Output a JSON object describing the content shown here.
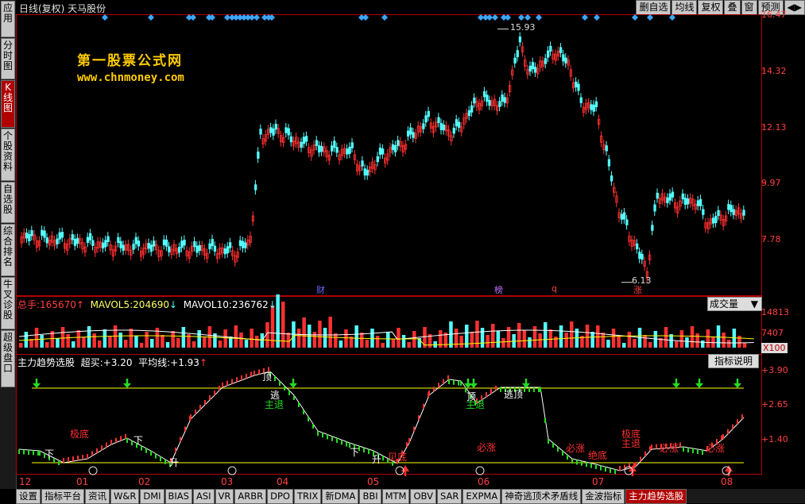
{
  "left_nav": [
    "应用",
    "分时图",
    "K线图",
    "个股资料",
    "自选股",
    "综合排名",
    "牛叉诊股",
    "超级盘口"
  ],
  "left_nav_active": 2,
  "top": {
    "title": "日线(复权)  天马股份",
    "buttons": [
      "删自选",
      "均线",
      "复权",
      "叠",
      "窗",
      "预测"
    ],
    "arrow": "◀▶"
  },
  "watermark": {
    "line1": "第一股票公式网",
    "line2": "www.chnmoney.com"
  },
  "price_axis": [
    "16.47",
    "14.32",
    "12.13",
    "9.97",
    "7.78"
  ],
  "annotations": {
    "high": "15.93",
    "low": "6.13",
    "mark_cai": "财",
    "mark_bang": "榜",
    "mark_q": "q",
    "mark_zhang": "涨"
  },
  "volume": {
    "legend_total_label": "总手:",
    "legend_total": "165670",
    "ma5_label": "MAVOL5:",
    "ma5": "204690",
    "ma10_label": "MAVOL10:",
    "ma10": "236762",
    "dropdown": "成交量",
    "axis": [
      "14813",
      "7407",
      "X100"
    ]
  },
  "indicator": {
    "name": "主力趋势选股",
    "buy_label": "超买:",
    "buy": "+3.20",
    "avg_label": "平均线:",
    "avg": "+1.93",
    "button": "指标说明",
    "axis": [
      "+3.90",
      "+2.65",
      "+1.40"
    ],
    "labels": [
      "极底",
      "顶",
      "逃",
      "主退",
      "顶",
      "主退",
      "逃顶",
      "必涨",
      "绝底",
      "极底",
      "主退",
      "必涨",
      "必涨",
      "必涨",
      "见底",
      "下",
      "下",
      "下",
      "升",
      "升"
    ]
  },
  "time_axis": [
    "12",
    "01",
    "02",
    "03",
    "04",
    "05",
    "06",
    "07",
    "08"
  ],
  "bottom_tabs": [
    "设置",
    "指标平台",
    "资讯",
    "W&R",
    "DMI",
    "BIAS",
    "ASI",
    "VR",
    "ARBR",
    "DPO",
    "TRIX",
    "新DMA",
    "BBI",
    "MTM",
    "OBV",
    "SAR",
    "EXPMA",
    "神奇逃顶术矛盾线",
    "金波指标",
    "主力趋势选股"
  ],
  "bottom_active": 19,
  "chart_data": {
    "type": "candlestick",
    "title": "日线(复权) 天马股份",
    "y_axis": [
      7.78,
      9.97,
      12.13,
      14.32,
      16.47
    ],
    "high": 15.93,
    "low": 6.13,
    "x_ticks": [
      "12",
      "01",
      "02",
      "03",
      "04",
      "05",
      "06",
      "07",
      "08"
    ]
  },
  "colors": {
    "up": "#ff3030",
    "down": "#54ffff",
    "axis": "#ff4040",
    "grid": "#b00000",
    "ma": "#ffffff",
    "yellow": "#ffff00",
    "green_arrow": "#22dd22"
  }
}
